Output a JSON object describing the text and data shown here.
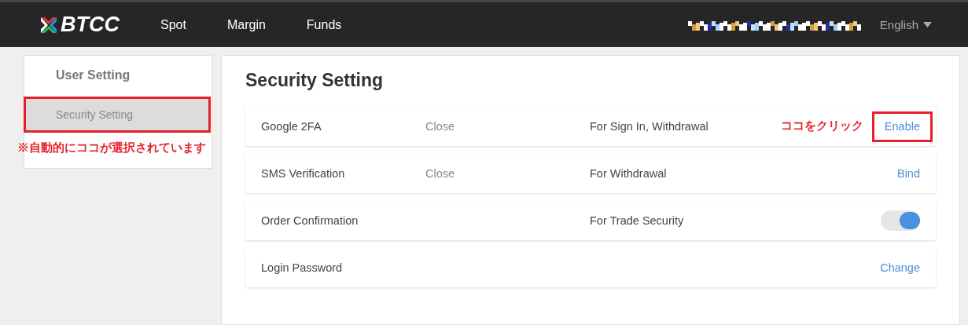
{
  "header": {
    "logo": "BTCC",
    "nav": [
      {
        "label": "Spot"
      },
      {
        "label": "Margin"
      },
      {
        "label": "Funds"
      }
    ],
    "language": "English"
  },
  "sidebar": {
    "title": "User Setting",
    "items": [
      {
        "label": "Security Setting",
        "selected": true,
        "highlighted": true
      }
    ],
    "note": "※自動的にココが選択されています"
  },
  "panel": {
    "title": "Security Setting",
    "rows": [
      {
        "name": "Google 2FA",
        "status": "Close",
        "purpose": "For Sign In, Withdrawal",
        "kind": "link",
        "action": "Enable",
        "highlighted": true,
        "note": "ココをクリック"
      },
      {
        "name": "SMS Verification",
        "status": "Close",
        "purpose": "For Withdrawal",
        "kind": "link",
        "action": "Bind",
        "highlighted": false
      },
      {
        "name": "Order Confirmation",
        "purpose": "For Trade Security",
        "kind": "toggle",
        "on": true
      },
      {
        "name": "Login Password",
        "kind": "link",
        "action": "Change",
        "highlighted": false
      }
    ]
  }
}
